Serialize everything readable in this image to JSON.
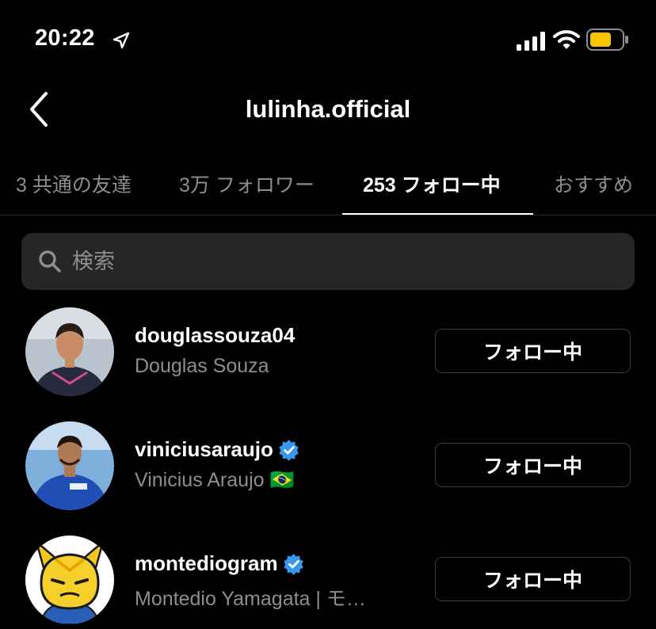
{
  "status_bar": {
    "time": "20:22"
  },
  "header": {
    "title": "lulinha.official"
  },
  "tabs": [
    {
      "label": "3 共通の友達"
    },
    {
      "label": "3万 フォロワー"
    },
    {
      "label": "253 フォロー中",
      "active": true
    },
    {
      "label": "おすすめ"
    }
  ],
  "search": {
    "placeholder": "検索"
  },
  "users": [
    {
      "username": "douglassouza04",
      "full_name": "Douglas Souza",
      "verified": false,
      "button": "フォロー中"
    },
    {
      "username": "viniciusaraujo",
      "full_name": "Vinicius Araujo 🇧🇷",
      "verified": true,
      "button": "フォロー中"
    },
    {
      "username": "montediogram",
      "full_name": "Montedio Yamagata | モ…",
      "verified": true,
      "button": "フォロー中"
    }
  ],
  "colors": {
    "background": "#000000",
    "secondary_text": "#8e8e8e",
    "search_bg": "#262626",
    "verified": "#3897f0",
    "battery": "#f7c600"
  }
}
